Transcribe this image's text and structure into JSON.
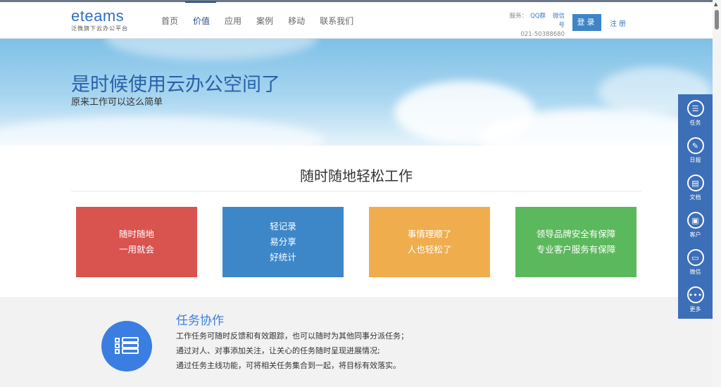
{
  "header": {
    "logo": "eteams",
    "logo_sub": "泛微旗下云办公平台",
    "nav": [
      "首页",
      "价值",
      "应用",
      "案例",
      "移动",
      "联系我们"
    ],
    "active_nav": 1,
    "service_label": "服务：",
    "qq": "QQ群",
    "wechat": "微信号",
    "phone": "021-50388680",
    "login": "登录",
    "register": "注册"
  },
  "banner": {
    "title": "是时候使用云办公空间了",
    "subtitle": "原来工作可以这么简单"
  },
  "section": {
    "title": "随时随地轻松工作",
    "cards": [
      {
        "lines": [
          "随时随地",
          "一用就会"
        ],
        "color": "#d9534f"
      },
      {
        "lines": [
          "轻记录",
          "易分享",
          "好统计"
        ],
        "color": "#3d87c9"
      },
      {
        "lines": [
          "事情理顺了",
          "人也轻松了"
        ],
        "color": "#f0ad4e"
      },
      {
        "lines": [
          "领导品牌安全有保障",
          "专业客户服务有保障"
        ],
        "color": "#5cb85c"
      }
    ]
  },
  "feature": {
    "title": "任务协作",
    "lines": [
      "工作任务可随时反馈和有效跟踪，也可以随时为其他同事分派任务；",
      "通过对人、对事添加关注，让关心的任务随时呈现进展情况;",
      "通过任务主线功能，可将相关任务集合到一起，将目标有效落实。"
    ]
  },
  "side": [
    {
      "label": "任务",
      "icon": "list-icon"
    },
    {
      "label": "日报",
      "icon": "edit-icon"
    },
    {
      "label": "文档",
      "icon": "document-icon"
    },
    {
      "label": "客户",
      "icon": "contact-icon"
    },
    {
      "label": "微信",
      "icon": "chat-icon"
    },
    {
      "label": "更多",
      "icon": "more-icon"
    }
  ]
}
